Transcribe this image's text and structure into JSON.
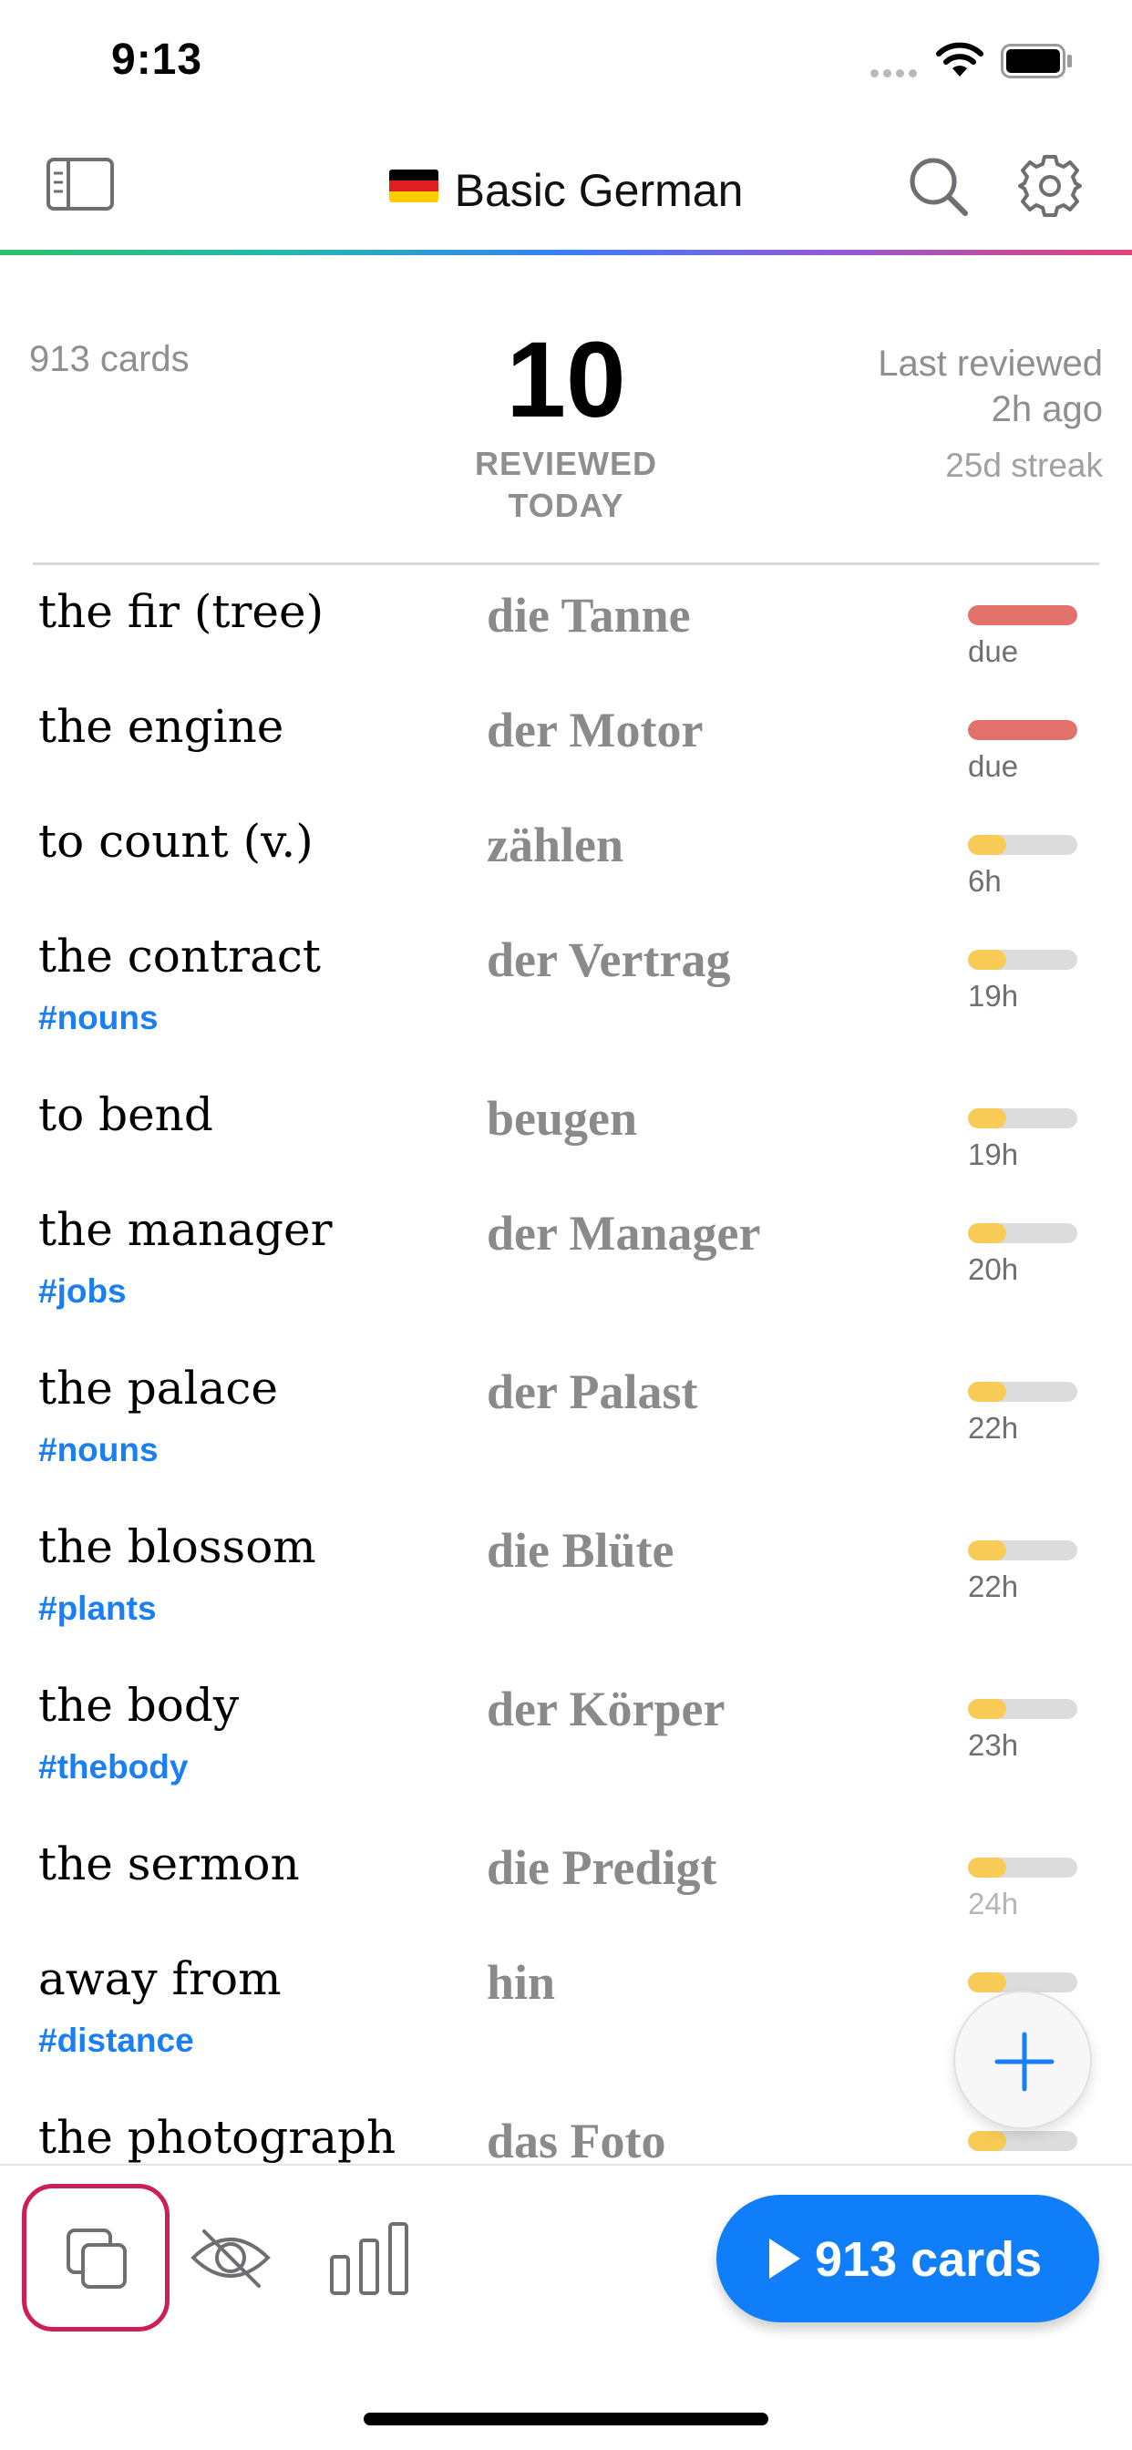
{
  "status_bar": {
    "time": "9:13"
  },
  "nav": {
    "title": "Basic German",
    "flag": "germany-flag"
  },
  "stats": {
    "card_count": "913 cards",
    "reviewed_count": "10",
    "reviewed_label_1": "REVIEWED",
    "reviewed_label_2": "TODAY",
    "last_reviewed_1": "Last reviewed",
    "last_reviewed_2": "2h ago",
    "streak": "25d streak"
  },
  "colors": {
    "accent": "#0f7ef8",
    "due": "#e2716c",
    "pending": "#f7cb56",
    "tag": "#1a7ef5",
    "selected_tab_border": "#cc1f53"
  },
  "cards": [
    {
      "front": "the fir (tree)",
      "back": "die Tanne",
      "tag": "",
      "due": "due",
      "progress": 1.0,
      "status": "due"
    },
    {
      "front": "the engine",
      "back": "der Motor",
      "tag": "",
      "due": "due",
      "progress": 1.0,
      "status": "due"
    },
    {
      "front": "to count (v.)",
      "back": "zählen",
      "tag": "",
      "due": "6h",
      "progress": 0.35,
      "status": "pending"
    },
    {
      "front": "the contract",
      "back": "der Vertrag",
      "tag": "#nouns",
      "due": "19h",
      "progress": 0.35,
      "status": "pending"
    },
    {
      "front": "to bend",
      "back": "beugen",
      "tag": "",
      "due": "19h",
      "progress": 0.35,
      "status": "pending"
    },
    {
      "front": "the manager",
      "back": "der Manager",
      "tag": "#jobs",
      "due": "20h",
      "progress": 0.35,
      "status": "pending"
    },
    {
      "front": "the palace",
      "back": "der Palast",
      "tag": "#nouns",
      "due": "22h",
      "progress": 0.35,
      "status": "pending"
    },
    {
      "front": "the blossom",
      "back": "die Blüte",
      "tag": "#plants",
      "due": "22h",
      "progress": 0.35,
      "status": "pending"
    },
    {
      "front": "the body",
      "back": "der Körper",
      "tag": "#thebody",
      "due": "23h",
      "progress": 0.35,
      "status": "pending"
    },
    {
      "front": "the sermon",
      "back": "die Predigt",
      "tag": "",
      "due": "24h",
      "progress": 0.35,
      "status": "pending"
    },
    {
      "front": "away from",
      "back": "hin",
      "tag": "#distance",
      "due": "",
      "progress": 0.35,
      "status": "pending"
    },
    {
      "front": "the photograph",
      "back": "das Foto",
      "tag": "",
      "due": "",
      "progress": 0.35,
      "status": "pending"
    }
  ],
  "toolbar": {
    "study_label": "913 cards"
  }
}
